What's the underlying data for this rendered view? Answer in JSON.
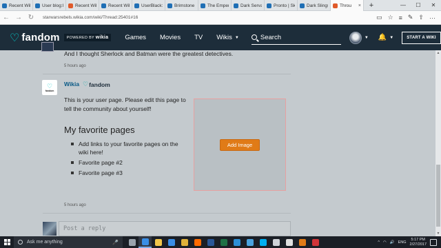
{
  "browser": {
    "tabs": [
      {
        "label": "Recent Wiki",
        "color": "#1f6fb5"
      },
      {
        "label": "User blog:l",
        "color": "#1f6fb5"
      },
      {
        "label": "Recent Wiki",
        "color": "#e05a2a"
      },
      {
        "label": "Recent Wiki",
        "color": "#1f6fb5"
      },
      {
        "label": "UserBlack:",
        "color": "#1f6fb5"
      },
      {
        "label": "Brimstone",
        "color": "#1f6fb5"
      },
      {
        "label": "The Emper",
        "color": "#1f6fb5"
      },
      {
        "label": "Dark Serva",
        "color": "#1f6fb5"
      },
      {
        "label": "Pronto | Sk",
        "color": "#1f6fb5"
      },
      {
        "label": "Dark Slings",
        "color": "#1f6fb5"
      },
      {
        "label": "Throu",
        "color": "#e05a2a",
        "active": true,
        "close": "×"
      }
    ],
    "new_tab": "+",
    "window_controls": {
      "minimize": "—",
      "maximize": "☐",
      "close": "✕"
    },
    "back_icon": "←",
    "forward_icon": "→",
    "refresh_icon": "↻",
    "url": "starwarsrebels.wikia.com/wiki/Thread:25401#16",
    "addr_icons": {
      "reading": "▭",
      "favorite": "☆",
      "hub": "≡",
      "note": "✎",
      "share": "⇧",
      "more": "···"
    }
  },
  "fandom_nav": {
    "logo_text": "fandom",
    "powered_by": "POWERED BY",
    "powered_by_brand": "wikia",
    "links": [
      {
        "label": "Games",
        "caret": false
      },
      {
        "label": "Movies",
        "caret": false
      },
      {
        "label": "TV",
        "caret": false
      },
      {
        "label": "Wikis",
        "caret": true
      }
    ],
    "search_label": "Search",
    "caret": "▼",
    "bell": "🔔",
    "start_wiki": "START A WIKI"
  },
  "thread": {
    "prev_comment_text": "And I thought Sherlock and Batman were the greatest detectives.",
    "prev_time": "5 hours ago",
    "author": "Wikia",
    "author_logo": "fandom",
    "avatar_label": "fandom",
    "body": "This is your user page. Please edit this page to tell the community about yourself!",
    "favorites_heading": "My favorite pages",
    "favorites": [
      "Add links to your favorite pages on the wiki here!",
      "Favorite page #2",
      "Favorite page #3"
    ],
    "add_image_label": "Add Image",
    "time": "5 hours ago",
    "reply_placeholder": "Post a reply"
  },
  "taskbar": {
    "search_placeholder": "Ask me anything",
    "mic": "🎤",
    "apps": [
      {
        "name": "task-view",
        "color": "#9aa3ad"
      },
      {
        "name": "edge",
        "color": "#3a8ee6",
        "active": true
      },
      {
        "name": "explorer",
        "color": "#f2c64a"
      },
      {
        "name": "store",
        "color": "#3a8ee6"
      },
      {
        "name": "chrome",
        "color": "#e0b13a"
      },
      {
        "name": "ie",
        "color": "#ff6a00"
      },
      {
        "name": "word",
        "color": "#2b5797"
      },
      {
        "name": "excel",
        "color": "#1e7145"
      },
      {
        "name": "onenote",
        "color": "#2b8fd6"
      },
      {
        "name": "app-blue",
        "color": "#4aa3df"
      },
      {
        "name": "skype",
        "color": "#00aff0"
      },
      {
        "name": "mail",
        "color": "#cfd3d8"
      },
      {
        "name": "calculator",
        "color": "#e0e0e0"
      },
      {
        "name": "app-orange",
        "color": "#e07b17"
      },
      {
        "name": "app-red",
        "color": "#d13438"
      }
    ],
    "tray": {
      "chevron": "^",
      "wifi": "◠",
      "volume": "🔊",
      "lang": "ENG",
      "time": "5:17 PM",
      "date": "2/27/2017"
    }
  }
}
